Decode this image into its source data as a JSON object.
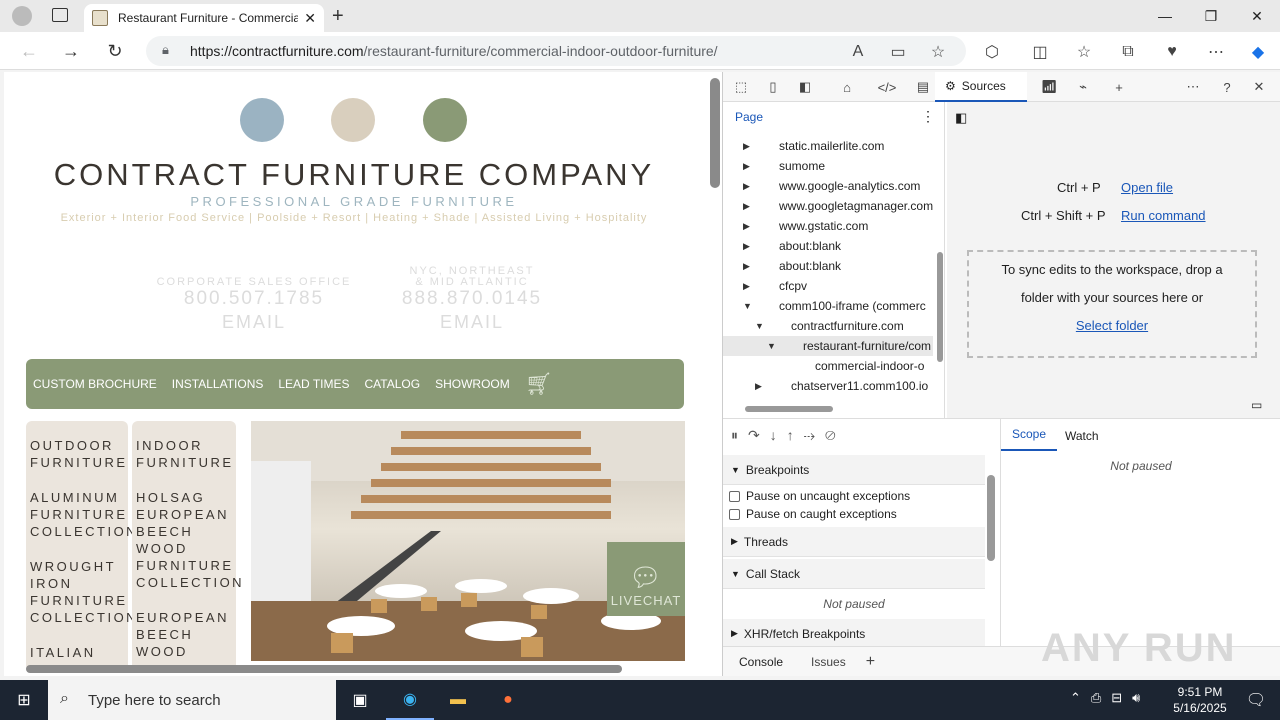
{
  "browser": {
    "tab_title": "Restaurant Furniture - Commercial",
    "new_tab": "+",
    "url_domain": "https://contractfurniture.com",
    "url_path": "/restaurant-furniture/commercial-indoor-outdoor-furniture/"
  },
  "site": {
    "company": "CONTRACT FURNITURE COMPANY",
    "tagline": "PROFESSIONAL GRADE FURNITURE",
    "services": "Exterior + Interior Food Service | Poolside + Resort | Heating + Shade | Assisted Living + Hospitality",
    "office1_label": "CORPORATE SALES OFFICE",
    "office1_phone": "800.507.1785",
    "office1_email": "EMAIL",
    "office2_label1": "NYC, NORTHEAST",
    "office2_label2": "& MID ATLANTIC",
    "office2_phone": "888.870.0145",
    "office2_email": "EMAIL",
    "nav": [
      "CUSTOM BROCHURE",
      "INSTALLATIONS",
      "LEAD TIMES",
      "CATALOG",
      "SHOWROOM"
    ],
    "col1": [
      "OUTDOOR FURNITURE",
      "ALUMINUM FURNITURE COLLECTIONS",
      "WROUGHT IRON FURNITURE COLLECTIONS",
      "ITALIAN"
    ],
    "col2": [
      "INDOOR FURNITURE",
      "HOLSAG EUROPEAN BEECH WOOD FURNITURE COLLECTION",
      "EUROPEAN BEECH WOOD"
    ],
    "livechat": "LIVECHAT"
  },
  "devtools": {
    "sources_tab": "Sources",
    "page_tab": "Page",
    "tree": [
      "static.mailerlite.com",
      "sumome",
      "www.google-analytics.com",
      "www.googletagmanager.com",
      "www.gstatic.com",
      "about:blank",
      "about:blank",
      "cfcpv",
      "comm100-iframe (commerc",
      "contractfurniture.com",
      "restaurant-furniture/com",
      "commercial-indoor-o",
      "chatserver11.comm100.io"
    ],
    "shortcut1_keys": "Ctrl + P",
    "shortcut1_label": "Open file",
    "shortcut2_keys": "Ctrl + Shift + P",
    "shortcut2_label": "Run command",
    "sync_text": "To sync edits to the workspace, drop a folder with your sources here or",
    "select_folder": "Select folder",
    "scope": "Scope",
    "watch": "Watch",
    "not_paused": "Not paused",
    "breakpoints": "Breakpoints",
    "pause_uncaught": "Pause on uncaught exceptions",
    "pause_caught": "Pause on caught exceptions",
    "threads": "Threads",
    "call_stack": "Call Stack",
    "xhr": "XHR/fetch Breakpoints",
    "console": "Console",
    "issues": "Issues"
  },
  "taskbar": {
    "search_placeholder": "Type here to search",
    "time": "9:51 PM",
    "date": "5/16/2025"
  },
  "watermark": "ANY RUN"
}
